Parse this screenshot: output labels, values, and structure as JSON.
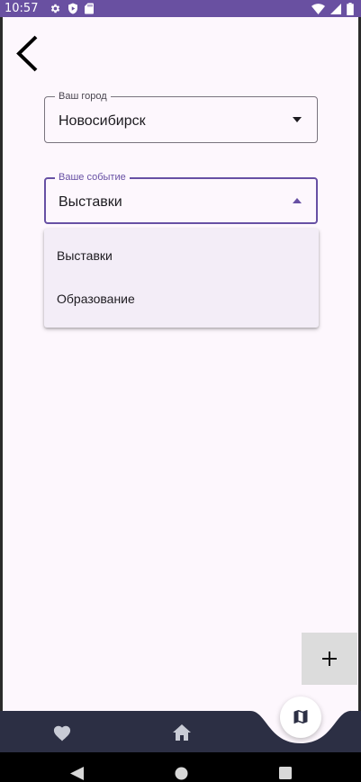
{
  "status_bar": {
    "time": "10:57",
    "background": "#6950a1",
    "icons_left": [
      "gear-icon",
      "shield-play-icon",
      "sd-card-icon"
    ],
    "icons_right": [
      "wifi-icon",
      "signal-icon",
      "battery-icon"
    ]
  },
  "header": {
    "back_icon": "chevron-left-icon"
  },
  "form": {
    "city": {
      "label": "Ваш город",
      "value": "Новосибирск"
    },
    "event": {
      "label": "Ваше событие",
      "value": "Выставки",
      "accent_color": "#6750a4"
    }
  },
  "dropdown": {
    "options": [
      {
        "label": "Выставки"
      },
      {
        "label": "Образование"
      }
    ]
  },
  "fab": {
    "icon": "plus-icon"
  },
  "bottom_nav": {
    "background": "#2c2f44",
    "items": [
      {
        "icon": "heart-icon"
      },
      {
        "icon": "home-icon"
      },
      {
        "icon": "map-icon"
      }
    ]
  },
  "system_nav": {
    "buttons": [
      "back-triangle-icon",
      "home-circle-icon",
      "recents-square-icon"
    ]
  }
}
